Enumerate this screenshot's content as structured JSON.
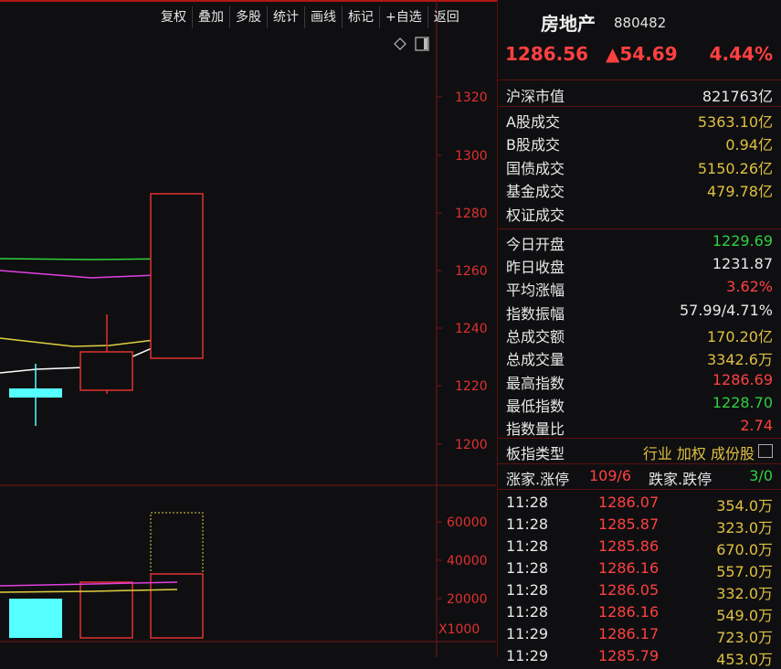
{
  "toolbar": [
    "复权",
    "叠加",
    "多股",
    "统计",
    "画线",
    "标记",
    "+自选",
    "返回"
  ],
  "header": {
    "name": "房地产",
    "code": "880482",
    "price": "1286.56",
    "change": "▲54.69",
    "change_pct": "4.44%"
  },
  "chart": {
    "price_axis": [
      "1320",
      "1300",
      "1280",
      "1260",
      "1240",
      "1220",
      "1200"
    ],
    "volume_axis": [
      "60000",
      "40000",
      "20000"
    ],
    "volume_unit": "X1000",
    "colors": {
      "up": "#e03030",
      "down": "#55ffff",
      "ma1": "#ffffff",
      "ma2": "#e0d040",
      "ma3": "#e040e0",
      "ma4": "#30d040"
    }
  },
  "stats": [
    {
      "label": "沪深市值",
      "value": "821763亿",
      "color": "w"
    },
    {
      "label": "A股成交",
      "value": "5363.10亿",
      "color": "y"
    },
    {
      "label": "B股成交",
      "value": "0.94亿",
      "color": "y"
    },
    {
      "label": "国债成交",
      "value": "5150.26亿",
      "color": "y"
    },
    {
      "label": "基金成交",
      "value": "479.78亿",
      "color": "y"
    },
    {
      "label": "权证成交",
      "value": "",
      "color": "y"
    },
    {
      "label": "今日开盘",
      "value": "1229.69",
      "color": "g"
    },
    {
      "label": "昨日收盘",
      "value": "1231.87",
      "color": "w"
    },
    {
      "label": "平均涨幅",
      "value": "3.62%",
      "color": "r"
    },
    {
      "label": "指数振幅",
      "value": "57.99/4.71%",
      "color": "w"
    },
    {
      "label": "总成交额",
      "value": "170.20亿",
      "color": "y"
    },
    {
      "label": "总成交量",
      "value": "3342.6万",
      "color": "y"
    },
    {
      "label": "最高指数",
      "value": "1286.69",
      "color": "r"
    },
    {
      "label": "最低指数",
      "value": "1228.70",
      "color": "g"
    },
    {
      "label": "指数量比",
      "value": "2.74",
      "color": "r"
    }
  ],
  "board_type": {
    "label": "板指类型",
    "value": "行业 加权 成份股"
  },
  "updown": {
    "up_label": "涨家.涨停",
    "up_value": "109/6",
    "down_label": "跌家.跌停",
    "down_value": "3/0"
  },
  "ticks": [
    {
      "time": "11:28",
      "price": "1286.07",
      "vol": "354.0万"
    },
    {
      "time": "11:28",
      "price": "1285.87",
      "vol": "323.0万"
    },
    {
      "time": "11:28",
      "price": "1285.86",
      "vol": "670.0万"
    },
    {
      "time": "11:28",
      "price": "1286.16",
      "vol": "557.0万"
    },
    {
      "time": "11:28",
      "price": "1286.05",
      "vol": "332.0万"
    },
    {
      "time": "11:28",
      "price": "1286.16",
      "vol": "549.0万"
    },
    {
      "time": "11:29",
      "price": "1286.17",
      "vol": "723.0万"
    },
    {
      "time": "11:29",
      "price": "1285.79",
      "vol": "453.0万"
    }
  ]
}
